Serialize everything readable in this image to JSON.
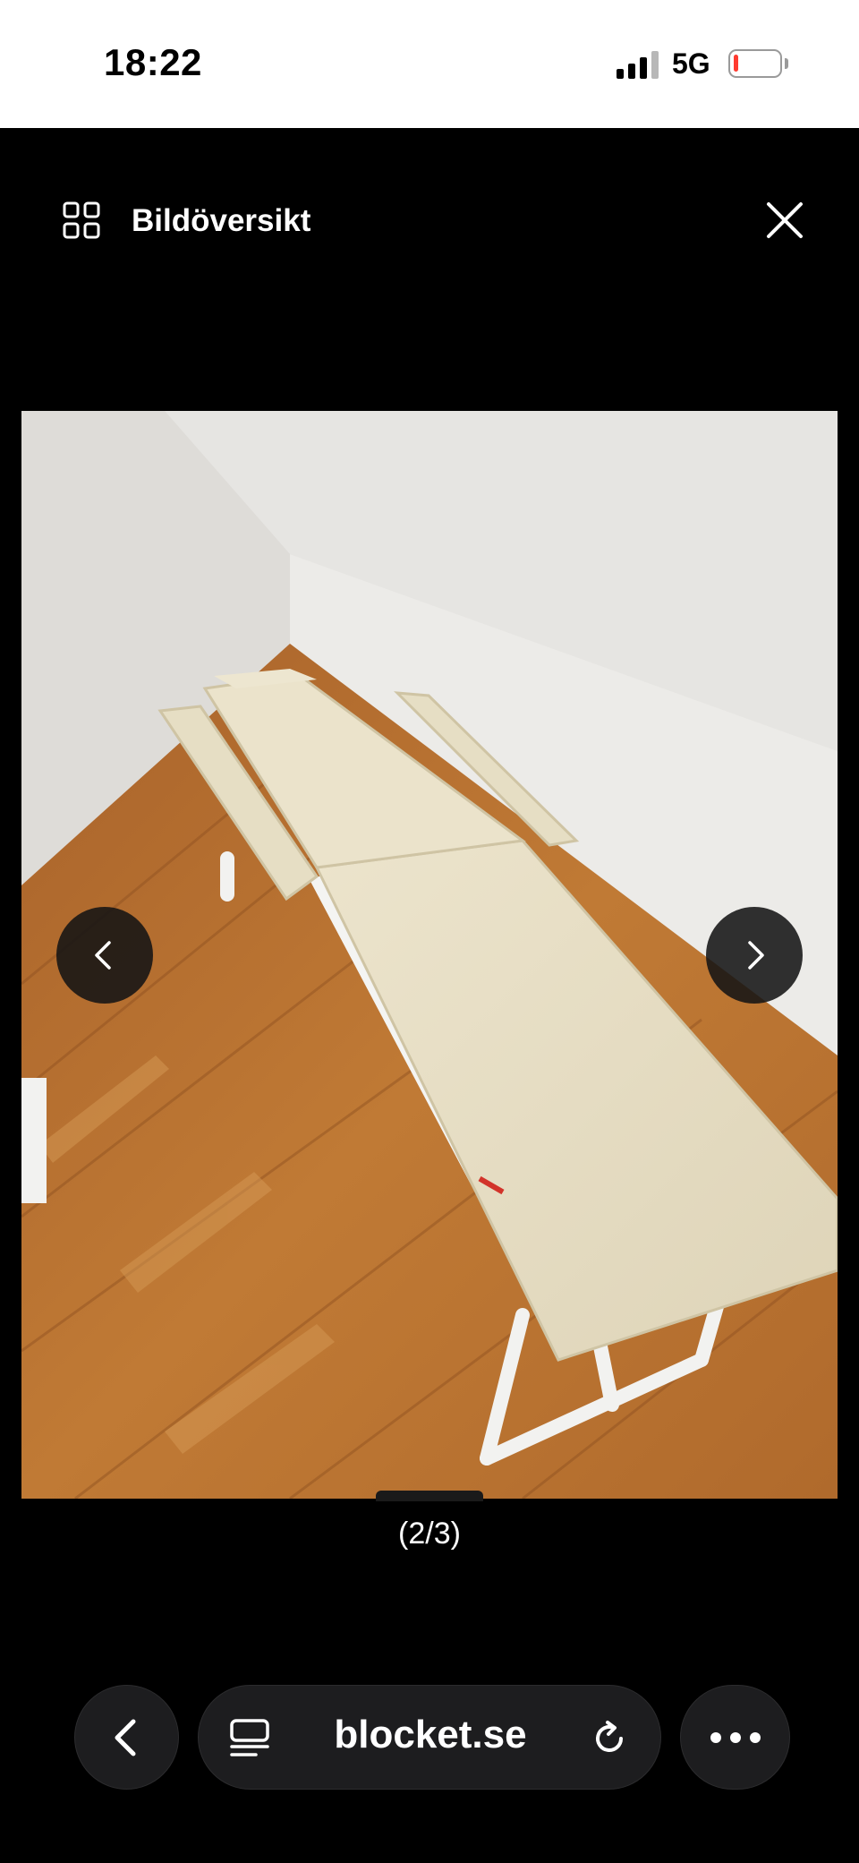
{
  "status_bar": {
    "time": "18:22",
    "network": "5G",
    "signal_bars_active": 3,
    "signal_bars_total": 4,
    "battery_level": 0.1,
    "battery_color": "#ff3b30"
  },
  "header": {
    "overview_icon": "grid-icon",
    "overview_label": "Bildöversikt",
    "close_icon": "close-icon"
  },
  "viewer": {
    "image_subject": "massage-table-photo",
    "prev_icon": "chevron-left-icon",
    "next_icon": "chevron-right-icon",
    "counter": "(2/3)"
  },
  "browser": {
    "back_icon": "chevron-left-icon",
    "reader_icon": "reader-mode-icon",
    "url": "blocket.se",
    "reload_icon": "reload-icon",
    "more_icon": "ellipsis-icon"
  }
}
